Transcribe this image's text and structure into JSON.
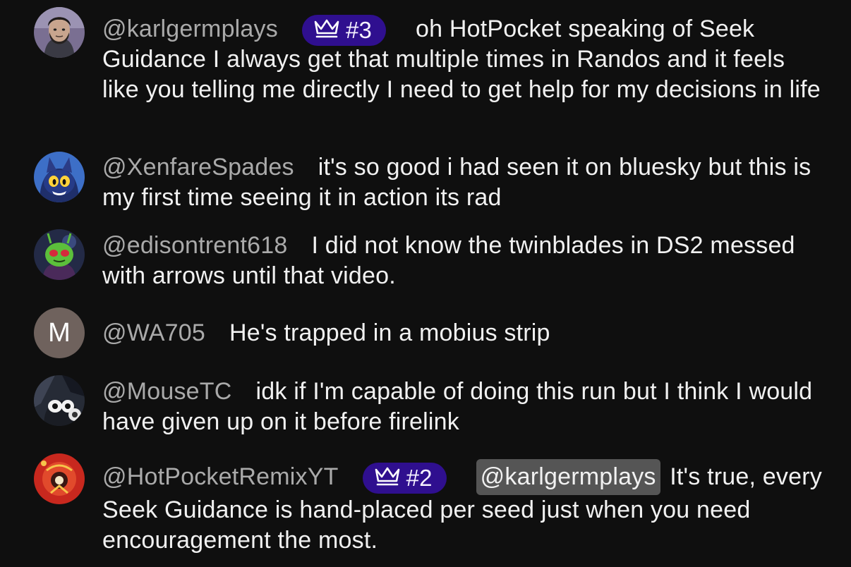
{
  "messages": [
    {
      "author": "@karlgermplays",
      "badge": {
        "label": "#3",
        "icon": "crown-icon"
      },
      "mention": "",
      "text": "oh HotPocket speaking of Seek Guidance I always get that multiple times in Randos and it feels like you telling me directly I need to get help for my decisions in life",
      "avatar": {
        "type": "photo",
        "description_icon": "bearded-man-avatar"
      }
    },
    {
      "author": "@XenfareSpades",
      "text": "it's so good i had seen it on bluesky but this is my first time seeing it in action its rad",
      "avatar": {
        "type": "photo",
        "description_icon": "cartoon-cat-avatar"
      }
    },
    {
      "author": "@edisontrent618",
      "text": "I did not know the twinblades in DS2 messed with arrows until that video.",
      "avatar": {
        "type": "photo",
        "description_icon": "green-alien-avatar"
      }
    },
    {
      "author": "@WA705",
      "text": "He's trapped in a mobius strip",
      "avatar": {
        "type": "letter",
        "letter": "M"
      }
    },
    {
      "author": "@MouseTC",
      "text": "idk if I'm capable of doing this run but I think I would have given up on it before firelink",
      "avatar": {
        "type": "photo",
        "description_icon": "mouse-character-avatar"
      }
    },
    {
      "author": "@HotPocketRemixYT",
      "badge": {
        "label": "#2",
        "icon": "crown-icon"
      },
      "mention": "@karlgermplays",
      "text": "It's true, every Seek Guidance is hand-placed per seed just when you need encouragement the most.",
      "avatar": {
        "type": "photo",
        "description_icon": "red-emblem-avatar"
      }
    }
  ],
  "colors": {
    "background": "#0f0f0f",
    "author": "#aaaaaa",
    "message_text": "#f1f1f1",
    "badge_bg": "#2f0f8f",
    "mention_bg": "#555555",
    "letter_avatar_bg": "#6f625d"
  }
}
